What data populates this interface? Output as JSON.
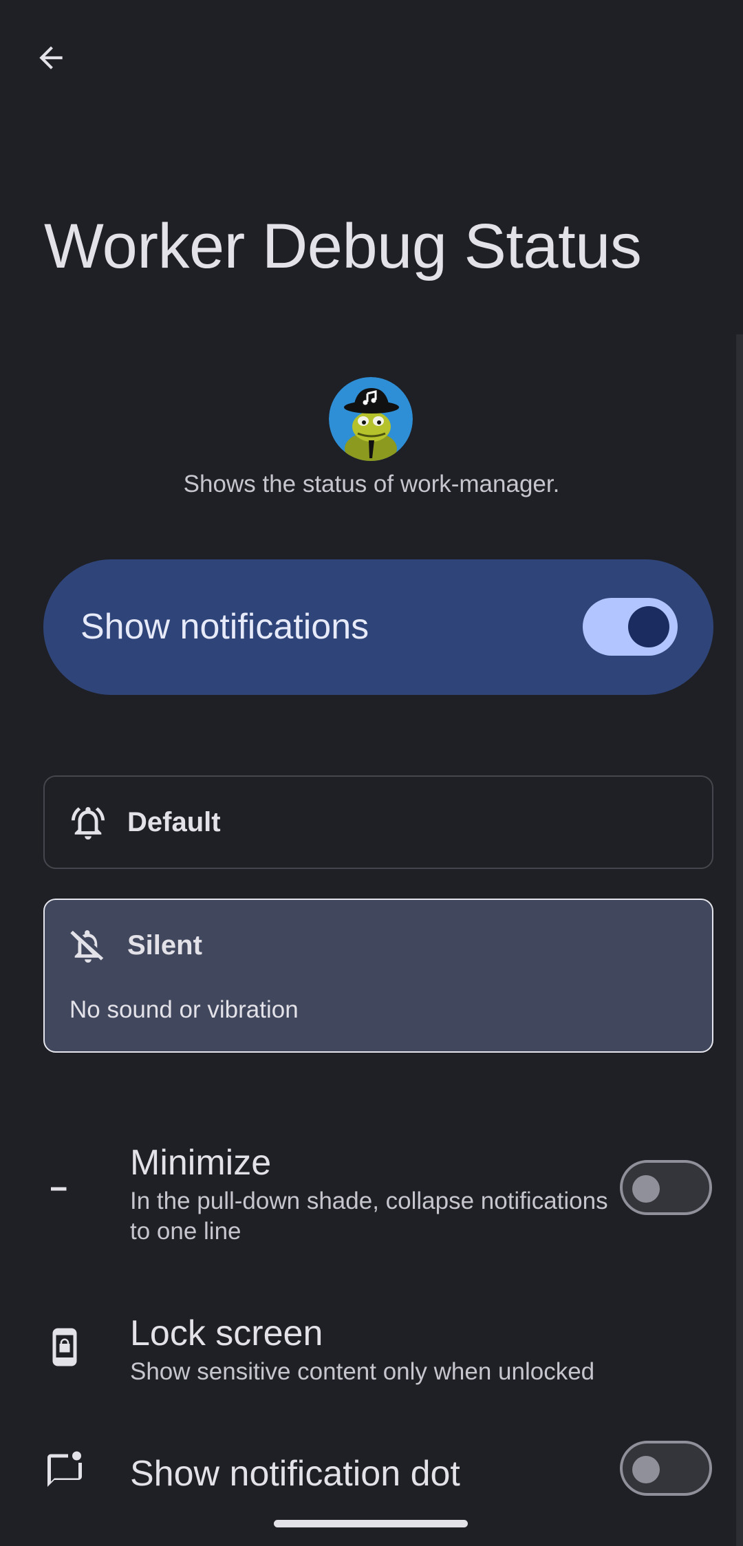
{
  "header": {
    "back_icon": "arrow-back-icon",
    "title": "Worker Debug Status"
  },
  "app": {
    "icon": "app-icon-frog",
    "description": "Shows the status of work-manager."
  },
  "main_switch": {
    "label": "Show notifications",
    "checked": true
  },
  "options": {
    "default": {
      "icon": "bell-ringing-icon",
      "title": "Default",
      "selected": false
    },
    "silent": {
      "icon": "bell-off-icon",
      "title": "Silent",
      "subtitle": "No sound or vibration",
      "selected": true
    }
  },
  "settings": {
    "minimize": {
      "icon": "minimize-icon",
      "title": "Minimize",
      "subtitle": "In the pull-down shade, collapse notifications to one line",
      "checked": false
    },
    "lock_screen": {
      "icon": "lock-screen-icon",
      "title": "Lock screen",
      "subtitle": "Show sensitive content only when unlocked"
    },
    "notification_dot": {
      "icon": "notification-dot-icon",
      "title": "Show notification dot",
      "checked": false
    }
  },
  "colors": {
    "background": "#1f2025",
    "switch_card": "#2f4478",
    "switch_on_track": "#b2c5ff",
    "switch_on_thumb": "#1b2c60",
    "selected_option_bg": "#41475c"
  }
}
